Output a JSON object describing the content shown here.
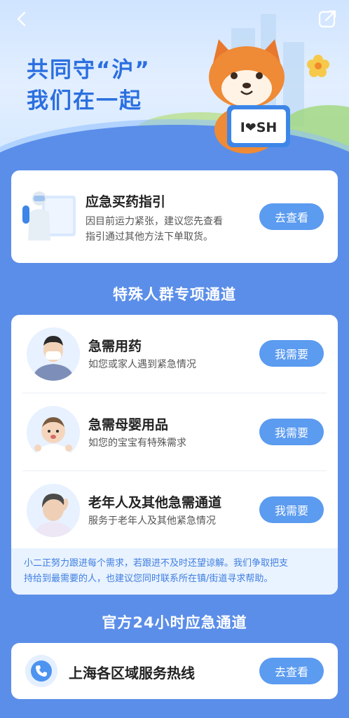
{
  "header": {
    "title_line1": "共同守“沪”",
    "title_line2": "我们在一起",
    "mascot_sign": "I❤SH",
    "back_icon": "chevron-left-icon",
    "share_icon": "external-link-icon"
  },
  "medicine_guide": {
    "title": "应急买药指引",
    "desc_line1": "因目前运力紧张，建议您先查看",
    "desc_line2": "指引通过其他方法下单取货。",
    "button": "去查看"
  },
  "special_section": {
    "title": "特殊人群专项通道",
    "items": [
      {
        "title": "急需用药",
        "desc": "如您或家人遇到紧急情况",
        "button": "我需要"
      },
      {
        "title": "急需母婴用品",
        "desc": "如您的宝宝有特殊需求",
        "button": "我需要"
      },
      {
        "title": "老年人及其他急需通道",
        "desc": "服务于老年人及其他紧急情况",
        "button": "我需要"
      }
    ],
    "note_line1": "小二正努力跟进每个需求，若跟进不及时还望谅解。我们争取把支",
    "note_line2": "持给到最需要的人，也建议您同时联系所在镇/街道寻求帮助。"
  },
  "hotline_section": {
    "title": "官方24小时应急通道",
    "item_title": "上海各区域服务热线",
    "button": "去查看",
    "icon": "phone-icon"
  },
  "colors": {
    "background": "#5b8ee9",
    "button": "#5b9bf0",
    "title_blue": "#2b6fe0",
    "note_bg": "#e9f2ff"
  }
}
